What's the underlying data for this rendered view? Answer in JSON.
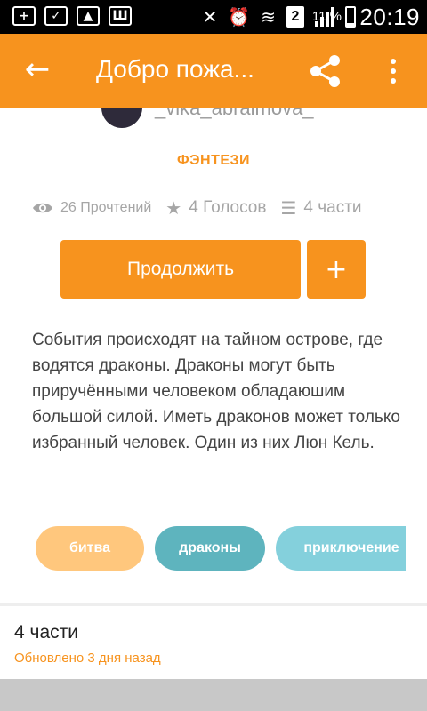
{
  "status_bar": {
    "icons_left": [
      "add-box-icon",
      "check-file-icon",
      "image-icon",
      "notification-icon"
    ],
    "sim_slot": "2",
    "battery_percent": "11 %",
    "time": "20:19"
  },
  "toolbar": {
    "title": "Добро пожа...",
    "back_icon": "arrow-left-icon",
    "share_icon": "share-icon",
    "more_icon": "more-vertical-icon"
  },
  "story": {
    "author": "_vika_abraimova_",
    "genre": "ФЭНТЕЗИ",
    "reads_count": "26 Прочтений",
    "votes_count": "4 Голосов",
    "parts_count": "4 части",
    "continue_label": "Продолжить",
    "add_label": "+",
    "description": "События происходят на тайном острове, где водятся драконы. Драконы могут быть приручёнными человеком обладаюшим большой силой. Иметь драконов может только избранный человек. Один из них Люн Кель.",
    "tags": [
      "битва",
      "драконы",
      "приключение"
    ]
  },
  "parts_section": {
    "header": "4 части",
    "updated": "Обновлено 3 дня назад"
  },
  "colors": {
    "accent": "#f7931e",
    "tag_orange": "#ffc77d",
    "tag_teal": "#5eb4be",
    "tag_cyan": "#84d0dc"
  }
}
